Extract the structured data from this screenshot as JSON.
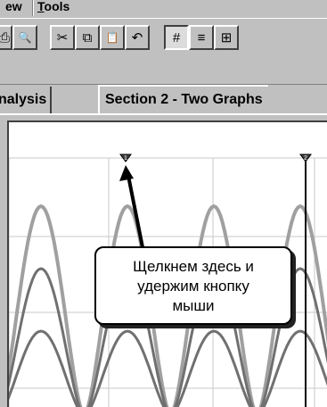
{
  "menu": {
    "items": [
      {
        "label": "ew"
      },
      {
        "label": "Tools"
      }
    ]
  },
  "toolbar": {
    "buttons": [
      {
        "icon": "print-icon",
        "glyph": "⎙"
      },
      {
        "icon": "print-preview-icon",
        "glyph": "🔍"
      },
      {
        "icon": "cut-icon",
        "glyph": "✂"
      },
      {
        "icon": "copy-icon",
        "glyph": "⧉"
      },
      {
        "icon": "paste-icon",
        "glyph": "📋"
      },
      {
        "icon": "undo-icon",
        "glyph": "↶"
      },
      {
        "icon": "grid-icon",
        "glyph": "#",
        "pressed": true
      },
      {
        "icon": "table-icon",
        "glyph": "≡"
      },
      {
        "icon": "chart-mode-icon",
        "glyph": "⊞"
      }
    ]
  },
  "tabs": [
    {
      "label": "nalysis"
    },
    {
      "label": "Section 2 - Two Graphs"
    }
  ],
  "callout": {
    "lines": [
      "Щелкнем здесь и",
      "удержим кнопку",
      "мыши"
    ]
  },
  "markers": [
    {
      "label": "1"
    },
    {
      "label": "2"
    }
  ],
  "colors": {
    "wave": "#a0a0a0",
    "wave_dark": "#707070",
    "grid": "#c8c8c8"
  }
}
